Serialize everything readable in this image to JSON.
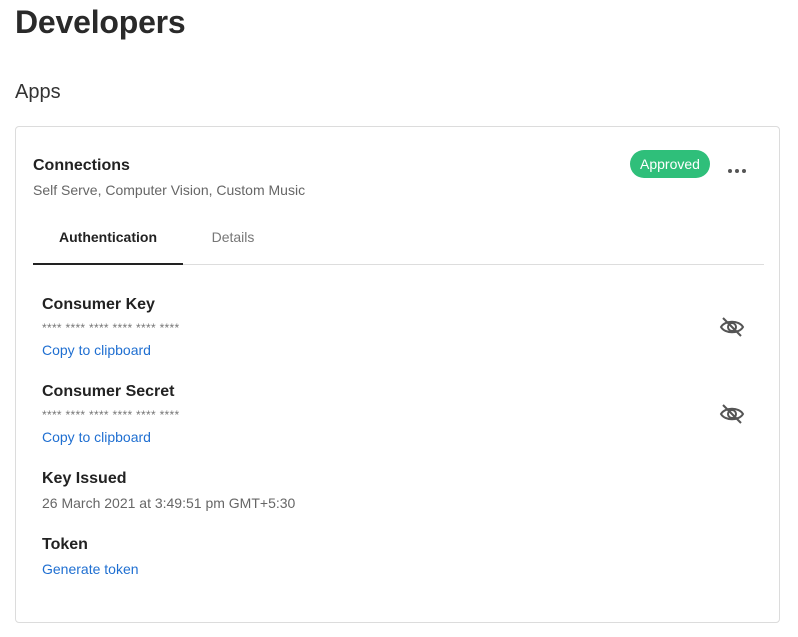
{
  "page": {
    "title": "Developers",
    "section_title": "Apps"
  },
  "app": {
    "name": "Connections",
    "subtitle": "Self Serve, Computer Vision, Custom Music",
    "status": "Approved",
    "status_color": "#2fbf7a"
  },
  "tabs": [
    {
      "label": "Authentication",
      "active": true
    },
    {
      "label": "Details",
      "active": false
    }
  ],
  "fields": {
    "consumer_key": {
      "label": "Consumer Key",
      "value": "**** **** **** **** **** ****",
      "copy_label": "Copy to clipboard",
      "toggle_icon": "eye-off-icon"
    },
    "consumer_secret": {
      "label": "Consumer Secret",
      "value": "**** **** **** **** **** ****",
      "copy_label": "Copy to clipboard",
      "toggle_icon": "eye-off-icon"
    },
    "key_issued": {
      "label": "Key Issued",
      "value": "26 March 2021 at 3:49:51 pm GMT+5:30"
    },
    "token": {
      "label": "Token",
      "action_label": "Generate token"
    }
  },
  "colors": {
    "link": "#1f6fd1",
    "badge": "#2fbf7a"
  }
}
